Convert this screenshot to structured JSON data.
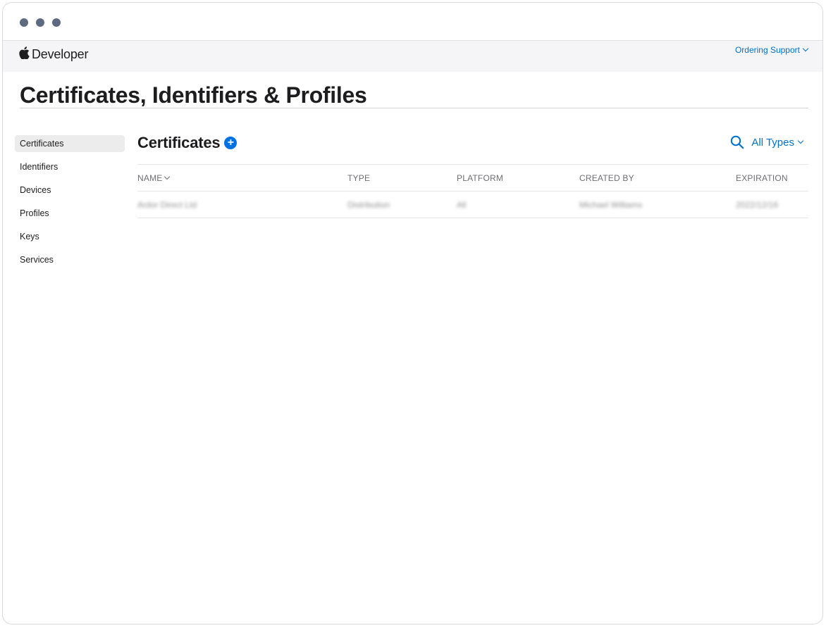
{
  "window": {
    "controls": [
      "close-dot",
      "minimize-dot",
      "zoom-dot"
    ],
    "control_color": "#5d6b80"
  },
  "nav": {
    "brand_label": "Developer",
    "support_link": "Ordering Support"
  },
  "page": {
    "title": "Certificates, Identifiers & Profiles"
  },
  "sidebar": {
    "items": [
      {
        "label": "Certificates",
        "active": true
      },
      {
        "label": "Identifiers",
        "active": false
      },
      {
        "label": "Devices",
        "active": false
      },
      {
        "label": "Profiles",
        "active": false
      },
      {
        "label": "Keys",
        "active": false
      },
      {
        "label": "Services",
        "active": false
      }
    ]
  },
  "section": {
    "title": "Certificates",
    "add_symbol": "+",
    "filter_label": "All Types"
  },
  "table": {
    "columns": [
      "NAME",
      "TYPE",
      "PLATFORM",
      "CREATED BY",
      "EXPIRATION"
    ],
    "rows": [
      {
        "name": "Ardor Direct Ltd",
        "type": "Distribution",
        "platform": "All",
        "created_by": "Michael Williams",
        "expiration": "2022/12/16"
      }
    ]
  },
  "icons": {
    "apple": "apple-logo-icon",
    "search": "search-icon",
    "add": "add-circle-icon",
    "chevron": "chevron-down-icon"
  },
  "colors": {
    "accent": "#0070c9",
    "add_button": "#0071e3",
    "text": "#1d1d1f",
    "muted": "#6e6e73",
    "nav_bg": "#f5f5f7",
    "active_bg": "#ececec"
  }
}
